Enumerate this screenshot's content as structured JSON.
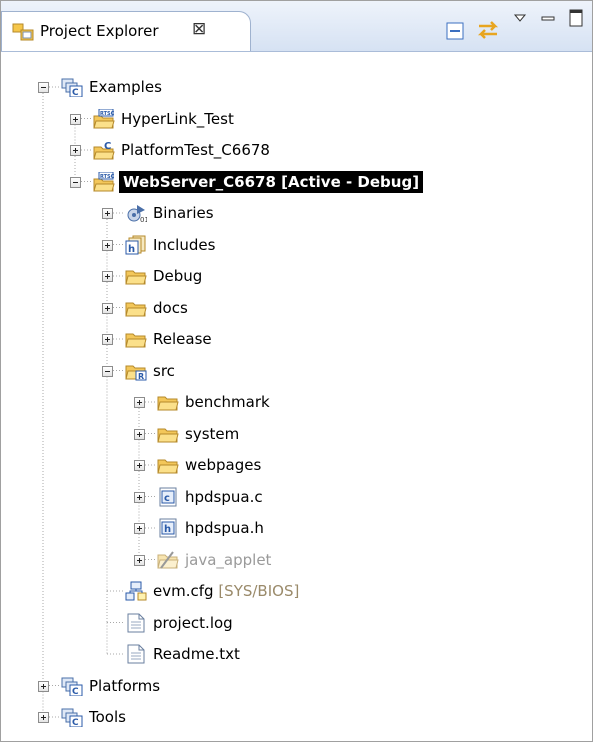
{
  "view": {
    "title": "Project Explorer",
    "close_glyph": "⊠",
    "icons": {
      "tab": "project-explorer-icon",
      "collapse_all": "collapse-all-icon",
      "link_with_editor": "link-with-editor-icon",
      "view_menu": "view-menu-icon",
      "minimize": "minimize-icon",
      "maximize": "maximize-icon"
    }
  },
  "tree": {
    "items": [
      {
        "label": "Examples",
        "expanded": true,
        "icon": "working-set-icon"
      },
      {
        "label": "HyperLink_Test",
        "expanded": false,
        "icon": "rtsc-project-icon"
      },
      {
        "label": "PlatformTest_C6678",
        "expanded": false,
        "icon": "ccs-project-icon"
      },
      {
        "label": "WebServer_C6678  [Active - Debug]",
        "expanded": true,
        "icon": "rtsc-project-icon",
        "selected": true
      },
      {
        "label": "Binaries",
        "expanded": false,
        "icon": "binaries-icon"
      },
      {
        "label": "Includes",
        "expanded": false,
        "icon": "includes-icon"
      },
      {
        "label": "Debug",
        "expanded": false,
        "icon": "folder-icon"
      },
      {
        "label": "docs",
        "expanded": false,
        "icon": "folder-icon"
      },
      {
        "label": "Release",
        "expanded": false,
        "icon": "folder-icon"
      },
      {
        "label": "src",
        "expanded": true,
        "icon": "source-folder-icon"
      },
      {
        "label": "benchmark",
        "expanded": false,
        "icon": "folder-icon"
      },
      {
        "label": "system",
        "expanded": false,
        "icon": "folder-icon"
      },
      {
        "label": "webpages",
        "expanded": false,
        "icon": "folder-icon"
      },
      {
        "label": "hpdspua.c",
        "expanded": false,
        "icon": "c-file-icon"
      },
      {
        "label": "hpdspua.h",
        "expanded": false,
        "icon": "h-file-icon"
      },
      {
        "label": "java_applet",
        "expanded": false,
        "icon": "excluded-folder-icon"
      },
      {
        "label": "evm.cfg",
        "suffix": "[SYS/BIOS]",
        "icon": "config-file-icon"
      },
      {
        "label": "project.log",
        "icon": "text-file-icon"
      },
      {
        "label": "Readme.txt",
        "icon": "text-file-icon"
      },
      {
        "label": "Platforms",
        "expanded": false,
        "icon": "working-set-icon"
      },
      {
        "label": "Tools",
        "expanded": false,
        "icon": "working-set-icon"
      }
    ]
  },
  "colors": {
    "header_top": "#eef3fb",
    "header_bottom": "#d6e2f3",
    "folder": "#f5c64a",
    "selection_bg": "#000000",
    "selection_fg": "#ffffff",
    "disabled_text": "#9a9a9a",
    "decoration_text": "#9a8a6a"
  }
}
